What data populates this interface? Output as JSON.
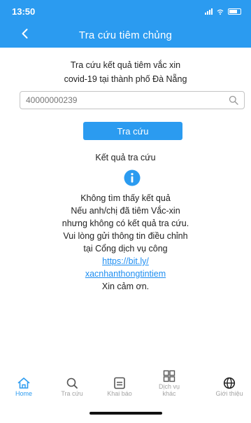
{
  "status_bar": {
    "time": "13:50",
    "icons": [
      "signal-icon",
      "wifi-icon",
      "battery-icon"
    ]
  },
  "header": {
    "back_icon": "chevron-left-icon",
    "title": "Tra cứu tiêm chủng",
    "color": "#2b9bf0"
  },
  "intro": {
    "line1": "Tra cứu kết quả tiêm vắc xin",
    "line2": "covid-19 tại thành phố Đà Nẵng"
  },
  "search": {
    "value": "40000000239",
    "icon": "search-icon"
  },
  "submit_button": {
    "label": "Tra cứu"
  },
  "results": {
    "heading": "Kết quả tra cứu",
    "icon": "info-icon",
    "lines": [
      "Không tìm thấy kết quả",
      "Nếu anh/chị đã tiêm Vắc-xin",
      "nhưng không có kết quả tra cứu.",
      "Vui lòng gửi thông tin điều chỉnh",
      "tại Cổng dịch vụ công"
    ],
    "link_line1": "https://bit.ly/",
    "link_line2": "xacnhanthongtintiem",
    "thanks": "Xin cảm ơn."
  },
  "tabbar": {
    "active_color": "#2b9bf0",
    "items": [
      {
        "label": "Home",
        "icon": "home-icon",
        "active": true
      },
      {
        "label": "Tra cứu",
        "icon": "search-icon",
        "active": false
      },
      {
        "label": "Khai báo",
        "icon": "document-icon",
        "active": false
      },
      {
        "label": "Dịch vụ",
        "label2": "khác",
        "icon": "grid-icon",
        "active": false
      },
      {
        "label": "Giới thiệu",
        "icon": "globe-icon",
        "active": false
      }
    ]
  }
}
